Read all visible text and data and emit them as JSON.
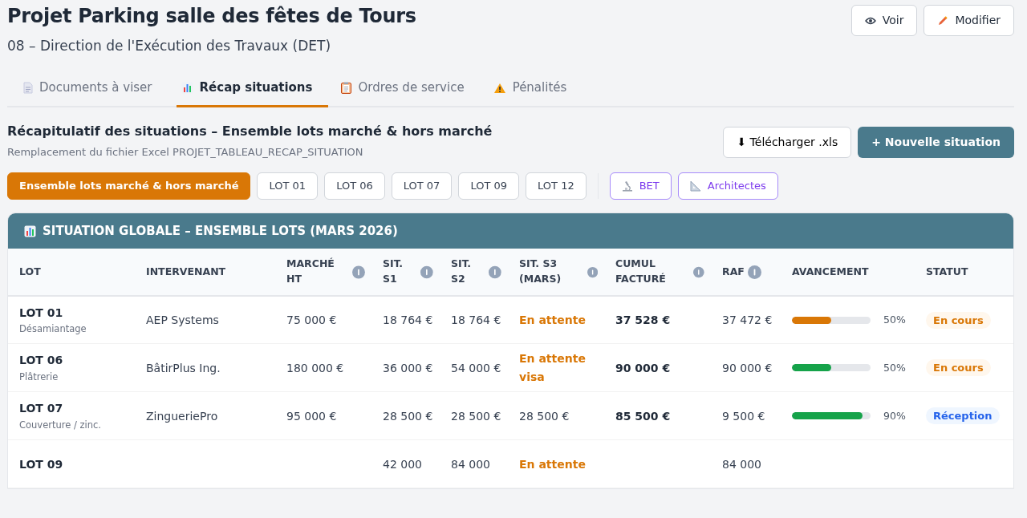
{
  "header": {
    "title": "Projet Parking salle des fêtes de Tours",
    "subtitle": "08 – Direction de l'Exécution des Travaux (DET)",
    "actions": [
      {
        "kind": "view",
        "label": "Voir"
      },
      {
        "kind": "edit",
        "label": "Modifier"
      }
    ]
  },
  "tabs": [
    {
      "kind": "doc",
      "label": "Documents à viser",
      "selected": false
    },
    {
      "kind": "chart",
      "label": "Récap situations",
      "selected": true
    },
    {
      "kind": "clipboard",
      "label": "Ordres de service",
      "selected": false
    },
    {
      "kind": "warning",
      "label": "Pénalités",
      "selected": false
    }
  ],
  "section": {
    "title": "Récapitulatif des situations – Ensemble lots marché & hors marché",
    "subtitle": "Remplacement du fichier Excel PROJET_TABLEAU_RECAP_SITUATION",
    "download_button": "⬇ Télécharger .xls",
    "new_button": "+ Nouvelle situation"
  },
  "filters": [
    {
      "label": "Ensemble lots marché & hors marché",
      "selected": true
    },
    {
      "label": "LOT 01",
      "selected": false
    },
    {
      "label": "LOT 06",
      "selected": false
    },
    {
      "label": "LOT 07",
      "selected": false
    },
    {
      "label": "LOT 09",
      "selected": false
    },
    {
      "label": "LOT 12",
      "selected": false
    }
  ],
  "group_filters": [
    {
      "kind": "microscope",
      "label": "BET",
      "selected": false
    },
    {
      "kind": "ruler",
      "label": "Architectes",
      "selected": false
    }
  ],
  "table": {
    "title": "SITUATION GLOBALE – ENSEMBLE LOTS (MARS 2026)",
    "columns": [
      {
        "label": "LOT",
        "info": false
      },
      {
        "label": "INTERVENANT",
        "info": false
      },
      {
        "label": "MARCHÉ HT",
        "info": true
      },
      {
        "label": "SIT. S1",
        "info": true
      },
      {
        "label": "SIT. S2",
        "info": true
      },
      {
        "label": "SIT. S3 (MARS)",
        "info": true
      },
      {
        "label": "CUMUL FACTURÉ",
        "info": true
      },
      {
        "label": "RAF",
        "info": true
      },
      {
        "label": "AVANCEMENT",
        "info": false
      },
      {
        "label": "STATUT",
        "info": false
      }
    ],
    "rows": [
      {
        "lot": "LOT 01",
        "lot_type": "Désamiantage",
        "intervenant": "AEP Systems",
        "marche": "75 000 €",
        "s1": "18 764 €",
        "s2": "18 764 €",
        "s3": "En attente",
        "s3_pending": true,
        "cumul": "37 528 €",
        "raf": "37 472 €",
        "level": 0.5,
        "progress": "50%",
        "color": "#d97706",
        "status": {
          "label": "En cours",
          "kind": "ongoing"
        }
      },
      {
        "lot": "LOT 06",
        "lot_type": "Plâtrerie",
        "intervenant": "BâtirPlus Ing.",
        "marche": "180 000 €",
        "s1": "36 000 €",
        "s2": "54 000 €",
        "s3": "En attente visa",
        "s3_pending": true,
        "cumul": "90 000 €",
        "raf": "90 000 €",
        "level": 0.5,
        "progress": "50%",
        "color": "#16a34a",
        "status": {
          "label": "En cours",
          "kind": "ongoing"
        }
      },
      {
        "lot": "LOT 07",
        "lot_type": "Couverture / zinc.",
        "intervenant": "ZingueriePro",
        "marche": "95 000 €",
        "s1": "28 500 €",
        "s2": "28 500 €",
        "s3": "28 500 €",
        "s3_pending": false,
        "cumul": "85 500 €",
        "raf": "9 500 €",
        "level": 0.9,
        "progress": "90%",
        "color": "#16a34a",
        "status": {
          "label": "Réception",
          "kind": "reception"
        }
      },
      {
        "lot": "LOT 09",
        "s1": "42 000",
        "s2": "84 000",
        "s3": "En attente",
        "s3_pending": true,
        "raf": "84 000"
      }
    ]
  }
}
